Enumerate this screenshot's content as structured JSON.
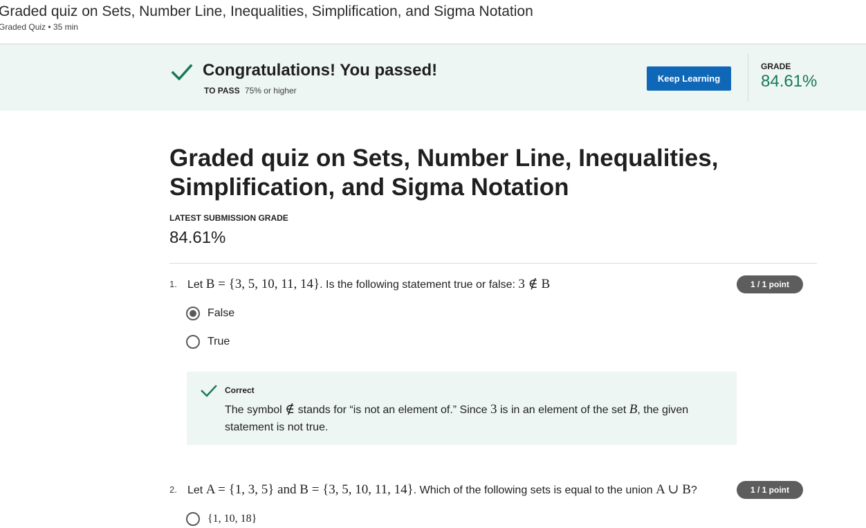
{
  "header": {
    "title": "Graded quiz on Sets, Number Line, Inequalities, Simplification, and Sigma Notation",
    "meta": "Graded Quiz • 35 min"
  },
  "banner": {
    "icon": "check-icon",
    "title": "Congratulations! You passed!",
    "to_pass_label": "TO PASS",
    "to_pass_value": "75% or higher",
    "keep_learning_label": "Keep Learning",
    "grade_label": "GRADE",
    "grade_value": "84.61%",
    "accent_color": "#0f67b8",
    "success_color": "#167a55"
  },
  "main": {
    "title": "Graded quiz on Sets, Number Line, Inequalities, Simplification, and Sigma Notation",
    "latest_label": "LATEST SUBMISSION GRADE",
    "latest_value": "84.61%"
  },
  "questions": [
    {
      "number": "1.",
      "text": {
        "lead": "Let ",
        "math1": "B = {3, 5, 10, 11, 14}",
        "mid": ". Is the following statement true or false: ",
        "math2": "3 ∉ B"
      },
      "points": "1 / 1 point",
      "options": [
        {
          "label": "False",
          "selected": true
        },
        {
          "label": "True",
          "selected": false
        }
      ],
      "feedback": {
        "title": "Correct",
        "text": {
          "a": "The symbol ",
          "sym": "∉",
          "b": " stands for “is not an element of.” Since ",
          "three": "3",
          "c": " is in an element of the set ",
          "set": "B",
          "d": ", the given statement is not true."
        }
      }
    },
    {
      "number": "2.",
      "text": {
        "lead": "Let ",
        "math1": "A = {1, 3, 5}",
        "and": " and ",
        "math2": "B = {3, 5, 10, 11, 14}",
        "mid": ". Which of the following sets is equal to the union ",
        "math3": "A ∪ B",
        "end": "?"
      },
      "points": "1 / 1 point",
      "options": [
        {
          "label": "{1, 10, 18}",
          "selected": false
        }
      ]
    }
  ]
}
